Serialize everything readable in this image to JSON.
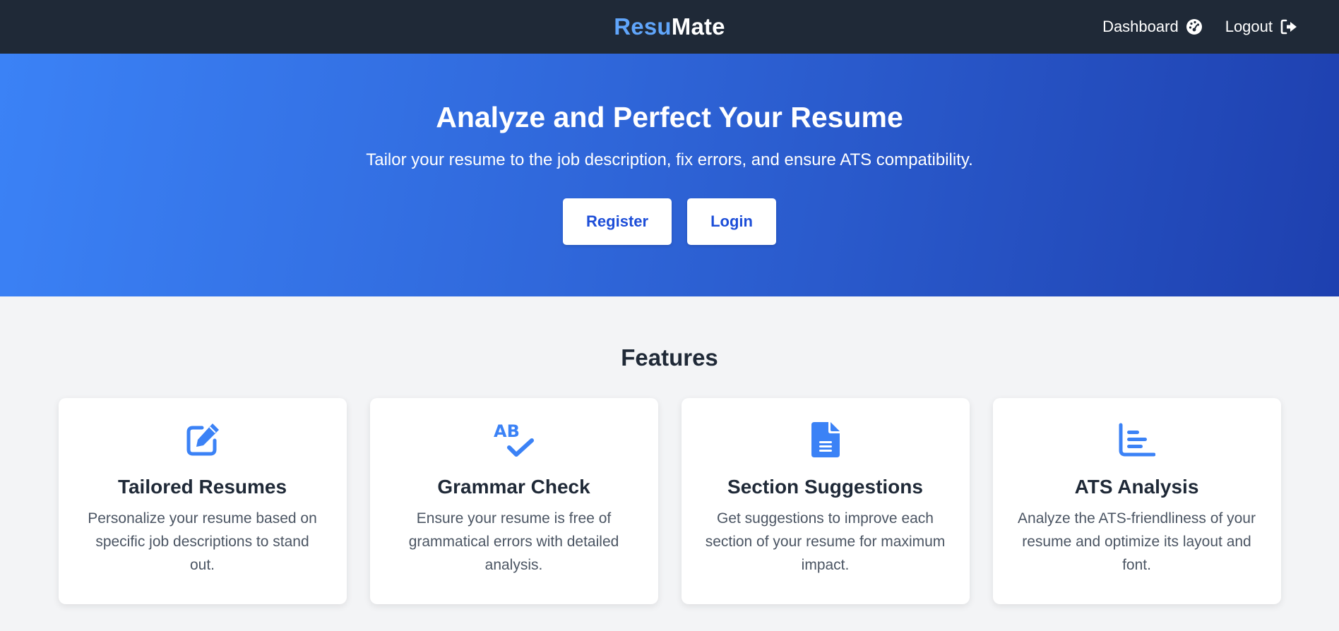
{
  "navbar": {
    "logo_part1": "Resu",
    "logo_part2": "Mate",
    "links": [
      {
        "label": "Dashboard",
        "icon": "dashboard-gauge-icon"
      },
      {
        "label": "Logout",
        "icon": "logout-icon"
      }
    ]
  },
  "hero": {
    "title": "Analyze and Perfect Your Resume",
    "subtitle": "Tailor your resume to the job description, fix errors, and ensure ATS compatibility.",
    "register_label": "Register",
    "login_label": "Login"
  },
  "features": {
    "heading": "Features",
    "cards": [
      {
        "title": "Tailored Resumes",
        "description": "Personalize your resume based on specific job descriptions to stand out.",
        "icon": "edit-icon"
      },
      {
        "title": "Grammar Check",
        "description": "Ensure your resume is free of grammatical errors with detailed analysis.",
        "icon": "spell-check-icon"
      },
      {
        "title": "Section Suggestions",
        "description": "Get suggestions to improve each section of your resume for maximum impact.",
        "icon": "file-icon"
      },
      {
        "title": "ATS Analysis",
        "description": "Analyze the ATS-friendliness of your resume and optimize its layout and font.",
        "icon": "bar-chart-icon"
      }
    ]
  },
  "colors": {
    "navbar_bg": "#1f2937",
    "logo_accent": "#60a5fa",
    "hero_gradient_start": "#3b82f6",
    "hero_gradient_end": "#1e40af",
    "button_text": "#1d4ed8",
    "icon_color": "#3b82f6",
    "page_bg": "#f3f4f6"
  }
}
